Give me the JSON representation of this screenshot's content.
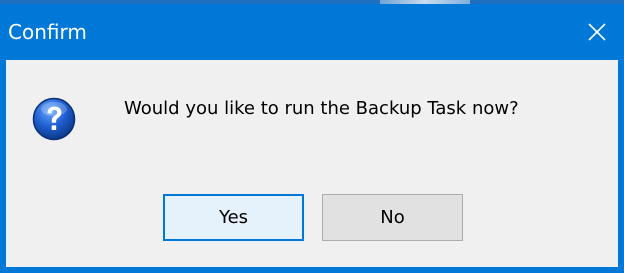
{
  "window": {
    "title": "Confirm",
    "close_icon": "close-icon"
  },
  "dialog": {
    "icon": "question-icon",
    "message": "Would you like to run the Backup Task now?"
  },
  "buttons": {
    "yes_label": "Yes",
    "no_label": "No"
  },
  "colors": {
    "titlebar": "#0078d7",
    "client_bg": "#f0f0f0",
    "default_button_border": "#0078d7",
    "button_bg": "#e1e1e1"
  }
}
